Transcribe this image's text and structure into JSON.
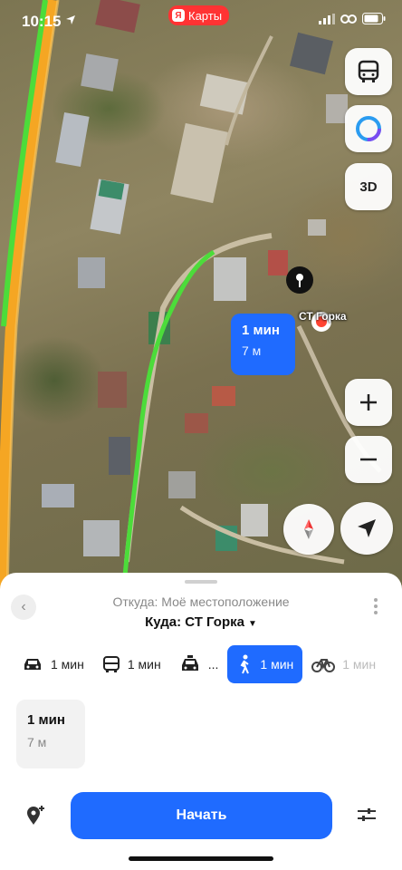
{
  "status": {
    "time": "10:15"
  },
  "brand": {
    "logo": "Я",
    "label": "Карты"
  },
  "map": {
    "controls": {
      "threed_label": "3D"
    },
    "route_bubble": {
      "time": "1 мин",
      "distance": "7 м"
    },
    "destination_label": "СТ Горка"
  },
  "sheet": {
    "from": "Откуда: Моё местоположение",
    "to": "Куда: СТ Горка",
    "modes": [
      {
        "icon": "car-icon",
        "label": "1 мин"
      },
      {
        "icon": "bus-icon",
        "label": "1 мин"
      },
      {
        "icon": "taxi-icon",
        "label": "..."
      },
      {
        "icon": "pedestrian-icon",
        "label": "1 мин"
      },
      {
        "icon": "bicycle-icon",
        "label": "1 мин"
      }
    ],
    "selected_mode": "pedestrian-icon",
    "route_card": {
      "time": "1 мин",
      "distance": "7 м"
    },
    "start_label": "Начать"
  },
  "colors": {
    "accent": "#1f6bff",
    "route_green": "#4cdc3a",
    "road_orange": "#f5a623",
    "brand_red": "#ff3333"
  }
}
